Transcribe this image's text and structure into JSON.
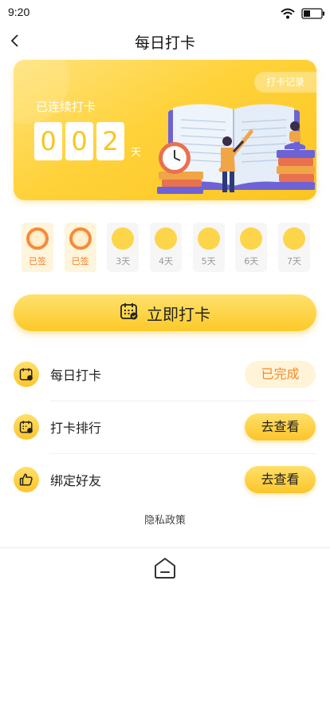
{
  "status_bar": {
    "time": "9:20",
    "icons": [
      "wifi-icon",
      "battery-icon"
    ]
  },
  "nav": {
    "title": "每日打卡",
    "back_icon": "chevron-left-icon"
  },
  "banner": {
    "record_button": "打卡记录",
    "streak_label": "已连续打卡",
    "digits": [
      "0",
      "0",
      "2"
    ],
    "unit": "天"
  },
  "week": [
    {
      "label": "已签",
      "signed": true
    },
    {
      "label": "已签",
      "signed": true
    },
    {
      "label": "3天",
      "signed": false
    },
    {
      "label": "4天",
      "signed": false
    },
    {
      "label": "5天",
      "signed": false
    },
    {
      "label": "6天",
      "signed": false
    },
    {
      "label": "7天",
      "signed": false
    }
  ],
  "checkin_button": {
    "label": "立即打卡",
    "icon": "calendar-check-icon"
  },
  "tasks": [
    {
      "icon": "calendar-check-icon",
      "label": "每日打卡",
      "button": "已完成",
      "status": "done"
    },
    {
      "icon": "calendar-rank-icon",
      "label": "打卡排行",
      "button": "去查看",
      "status": "go"
    },
    {
      "icon": "thumbs-up-icon",
      "label": "绑定好友",
      "button": "去查看",
      "status": "go"
    }
  ],
  "footer": {
    "privacy_link": "隐私政策",
    "home_icon": "home-icon"
  },
  "colors": {
    "accent": "#fcc929",
    "done_text": "#f08b2d",
    "signed_ring": "#f78a37"
  }
}
